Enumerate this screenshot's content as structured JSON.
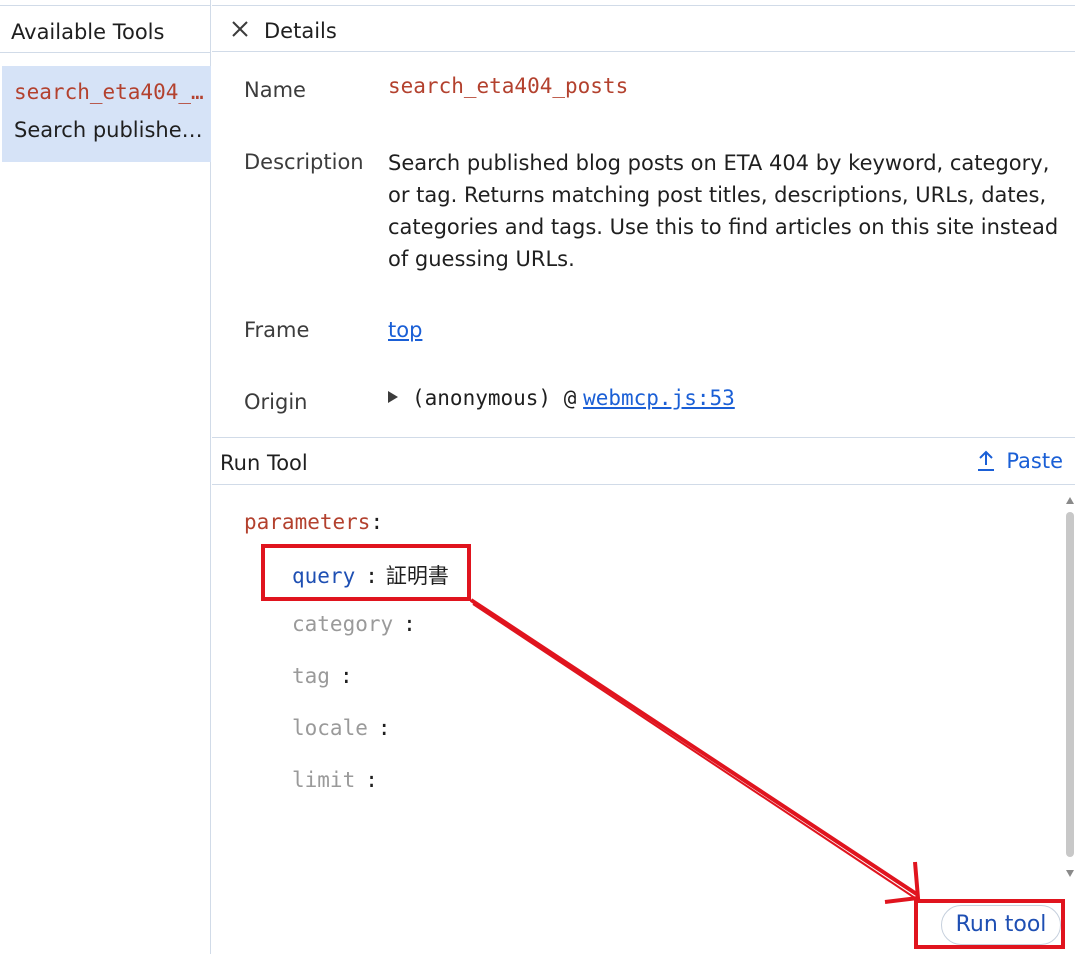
{
  "sidebar": {
    "title": "Available Tools",
    "tools": [
      {
        "name": "search_eta404_posts",
        "description": "Search published blog posts on ETA 404 by keyword, category, or tag."
      }
    ]
  },
  "details": {
    "title": "Details",
    "name_label": "Name",
    "name_value": "search_eta404_posts",
    "description_label": "Description",
    "description_value": "Search published blog posts on ETA 404 by keyword, category, or tag. Returns matching post titles, descriptions, URLs, dates, categories and tags. Use this to find articles on this site instead of guessing URLs.",
    "frame_label": "Frame",
    "frame_value": "top",
    "origin_label": "Origin",
    "origin_text": "(anonymous) @",
    "origin_link": "webmcp.js:53"
  },
  "run_tool": {
    "title": "Run Tool",
    "paste_label": "Paste",
    "params_root": "parameters",
    "params": [
      {
        "name": "query",
        "value": "証明書"
      },
      {
        "name": "category",
        "value": ""
      },
      {
        "name": "tag",
        "value": ""
      },
      {
        "name": "locale",
        "value": ""
      },
      {
        "name": "limit",
        "value": ""
      }
    ],
    "run_button": "Run tool"
  },
  "colors": {
    "accent": "#1a5fd6",
    "tool_name": "#b3412e",
    "selection": "#d6e3f7",
    "annotation": "#e0141e"
  },
  "icons": {
    "close": "close-icon",
    "paste": "upload-icon",
    "expand": "triangle-right-icon"
  }
}
